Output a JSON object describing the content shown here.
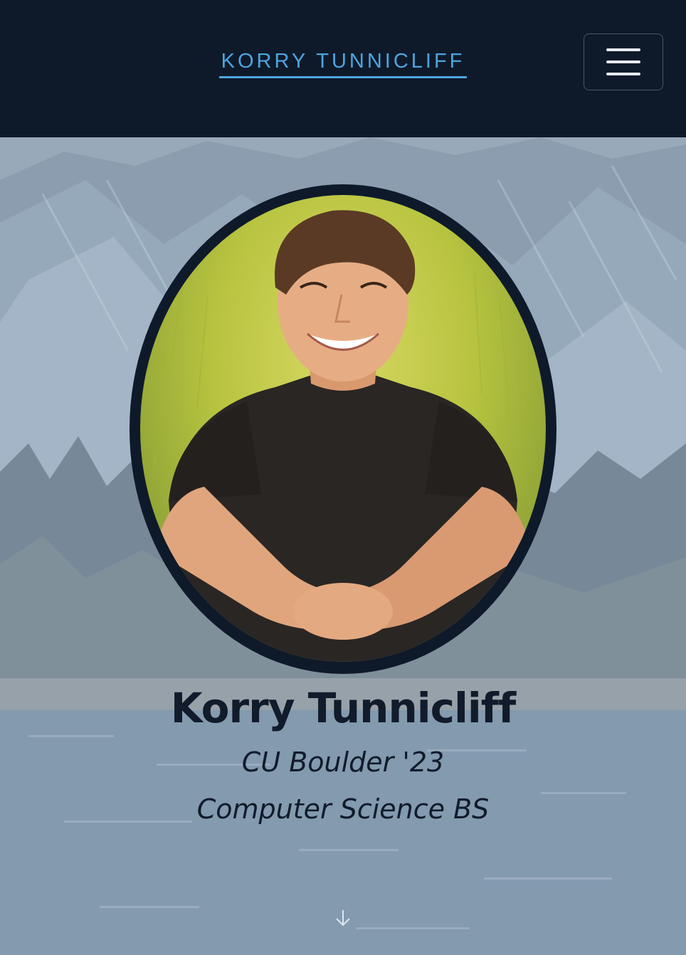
{
  "header": {
    "brand": "KORRY TUNNICLIFF",
    "menu_icon": "hamburger-menu-icon"
  },
  "hero": {
    "name": "Korry Tunnicliff",
    "school": "CU Boulder '23",
    "degree": "Computer Science BS",
    "scroll_icon": "arrow-down-icon"
  },
  "colors": {
    "nav_background": "#0e1a2a",
    "brand_accent": "#4ea4de",
    "heading_text": "#111b2b"
  }
}
